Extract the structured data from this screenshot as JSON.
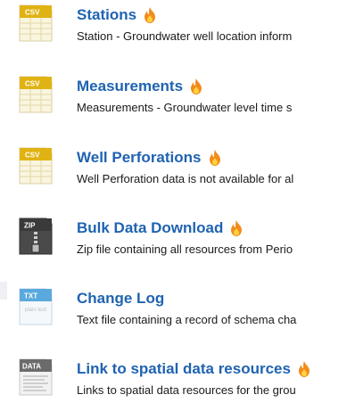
{
  "resources": [
    {
      "format": "CSV",
      "icon": "csv-file-icon",
      "title": "Stations",
      "description": "Station - Groundwater well location inform",
      "popular": true
    },
    {
      "format": "CSV",
      "icon": "csv-file-icon",
      "title": "Measurements",
      "description": "Measurements - Groundwater level time s",
      "popular": true
    },
    {
      "format": "CSV",
      "icon": "csv-file-icon",
      "title": "Well Perforations",
      "description": "Well Perforation data is not available for al",
      "popular": true
    },
    {
      "format": "ZIP",
      "icon": "zip-file-icon",
      "title": "Bulk Data Download",
      "description": "Zip file containing all resources from Perio",
      "popular": true
    },
    {
      "format": "TXT",
      "icon": "txt-file-icon",
      "icon_subtext": "plain text",
      "title": "Change Log",
      "description": "Text file containing a record of schema cha",
      "popular": false
    },
    {
      "format": "DATA",
      "icon": "data-file-icon",
      "title": "Link to spatial data resources",
      "description": "Links to spatial data resources for the grou",
      "popular": true
    }
  ],
  "colors": {
    "title_link": "#1f63b1",
    "csv_badge": "#e0b313",
    "zip_badge": "#3a3a3a",
    "txt_badge": "#5aa9de",
    "data_badge": "#6b6b6b",
    "flame_outer": "#f28c1c",
    "flame_inner": "#ffd23e"
  }
}
